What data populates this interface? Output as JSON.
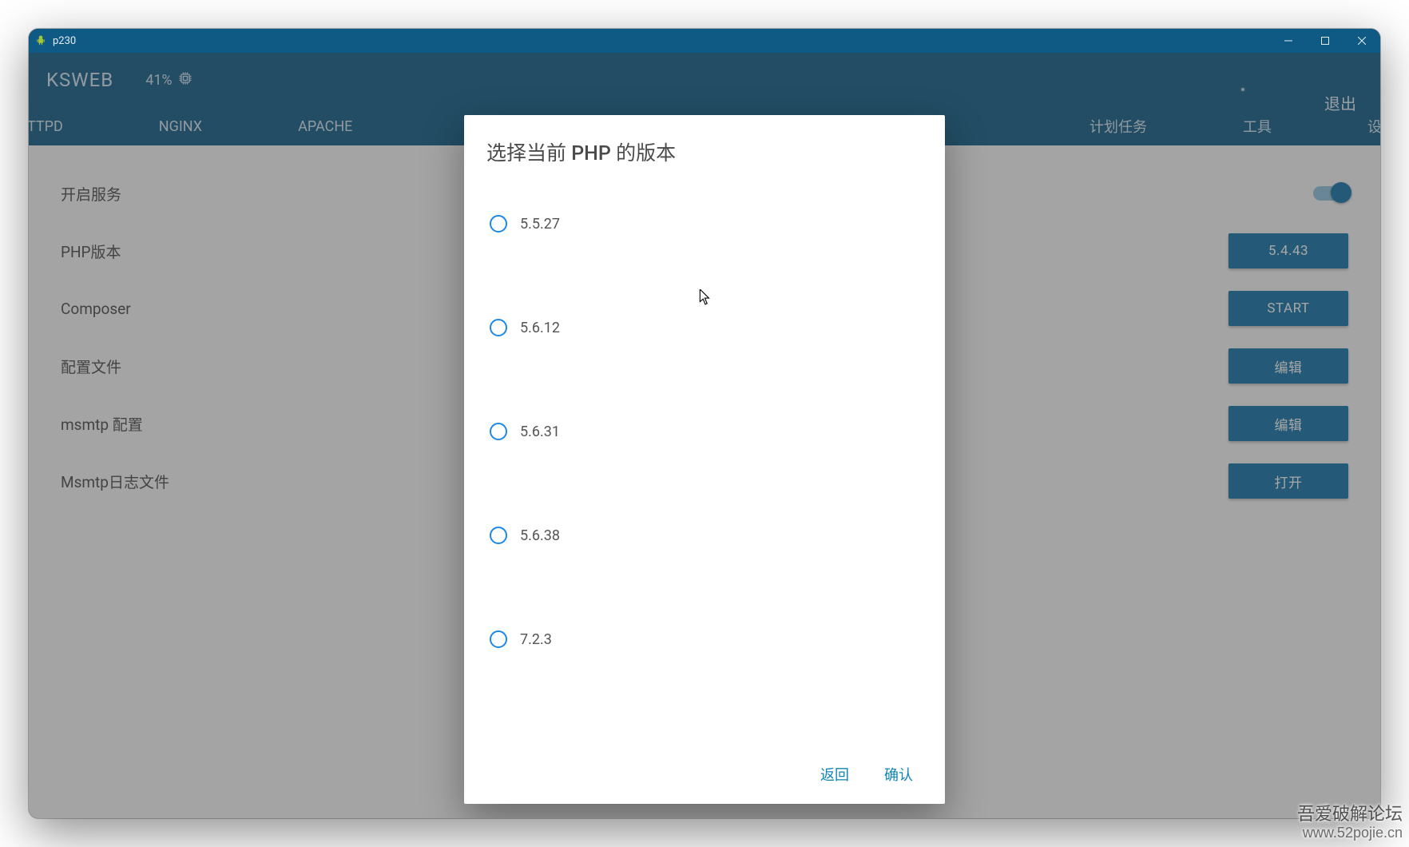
{
  "window": {
    "title": "p230"
  },
  "app": {
    "brand": "KSWEB",
    "battery": "41%",
    "exit": "退出"
  },
  "tabs": {
    "t0": "TTPD",
    "t1": "NGINX",
    "t2": "APACHE",
    "t3": "计划任务",
    "t4": "工具",
    "t5": "设"
  },
  "rows": {
    "service": {
      "label": "开启服务"
    },
    "php_version": {
      "label": "PHP版本",
      "value": "5.4.43"
    },
    "composer": {
      "label": "Composer",
      "value": "START"
    },
    "config": {
      "label": "配置文件",
      "value": "编辑"
    },
    "msmtp_config": {
      "label": "msmtp 配置",
      "value": "编辑"
    },
    "msmtp_log": {
      "label": "Msmtp日志文件",
      "value": "打开"
    }
  },
  "dialog": {
    "title": "选择当前 PHP 的版本",
    "options": {
      "o0": "5.5.27",
      "o1": "5.6.12",
      "o2": "5.6.31",
      "o3": "5.6.38",
      "o4": "7.2.3"
    },
    "back": "返回",
    "confirm": "确认"
  },
  "watermark": {
    "line1": "吾爱破解论坛",
    "line2": "www.52pojie.cn"
  }
}
